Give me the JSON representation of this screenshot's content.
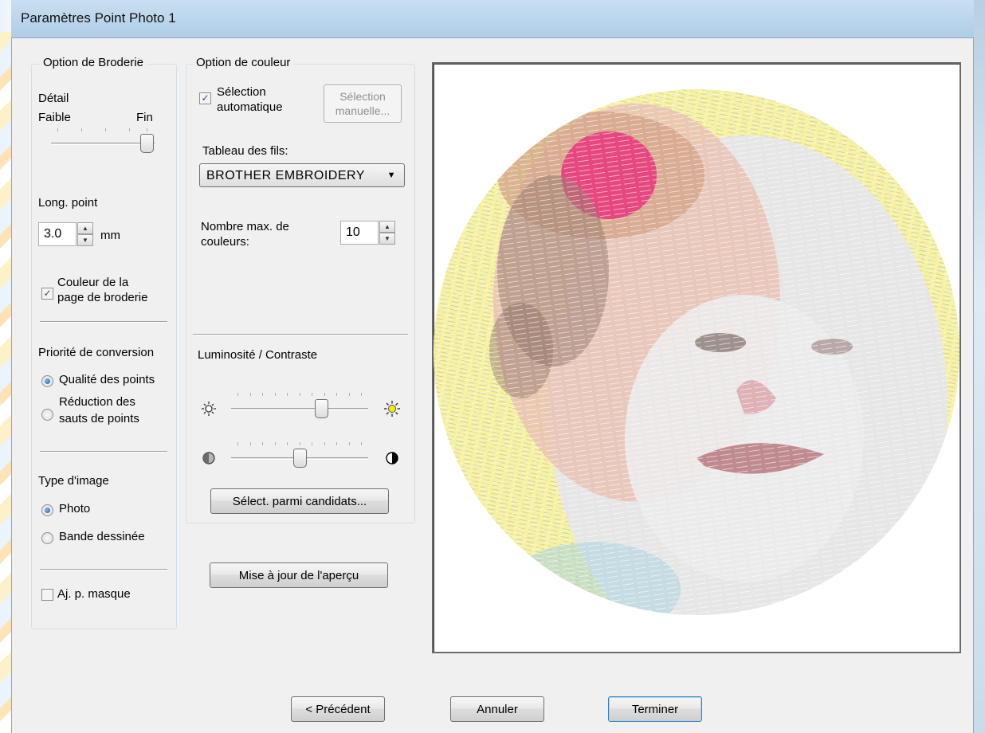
{
  "window": {
    "title": "Paramètres Point Photo 1"
  },
  "embroidery_option": {
    "group_label": "Option de Broderie",
    "detail_label": "Détail",
    "detail_low": "Faible",
    "detail_high": "Fin",
    "detail_level": 1.0,
    "stitch_length_label": "Long. point",
    "stitch_length_value": "3.0",
    "stitch_length_unit": "mm",
    "page_color_label": "Couleur de la\npage de broderie",
    "page_color_checked": true,
    "priority_label": "Priorité de conversion",
    "priority_quality": "Qualité des points",
    "priority_jumps": "Réduction des\nsauts de points",
    "priority_selected": "quality",
    "image_type_label": "Type d'image",
    "image_type_photo": "Photo",
    "image_type_comic": "Bande dessinée",
    "image_type_selected": "photo",
    "mask_label": "Aj. p. masque",
    "mask_checked": false
  },
  "color_option": {
    "group_label": "Option de couleur",
    "auto_select_label": "Sélection\nautomatique",
    "auto_select_checked": true,
    "manual_button_line1": "Sélection",
    "manual_button_line2": "manuelle...",
    "thread_table_label": "Tableau des fils:",
    "thread_table_value": "BROTHER EMBROIDERY",
    "max_colors_label": "Nombre max. de\ncouleurs:",
    "max_colors_value": "10",
    "brightness_contrast_label": "Luminosité / Contraste",
    "brightness_level": 0.68,
    "contrast_level": 0.5,
    "select_candidates_button": "Sélect. parmi candidats..."
  },
  "update_preview_button": "Mise à jour de l'aperçu",
  "footer": {
    "previous_button": "< Précédent",
    "cancel_button": "Annuler",
    "finish_button": "Terminer"
  },
  "colors": {
    "accent": "#3c7fb1",
    "preview_pink": "#e8357a",
    "preview_yellow": "#f6f2a0"
  }
}
